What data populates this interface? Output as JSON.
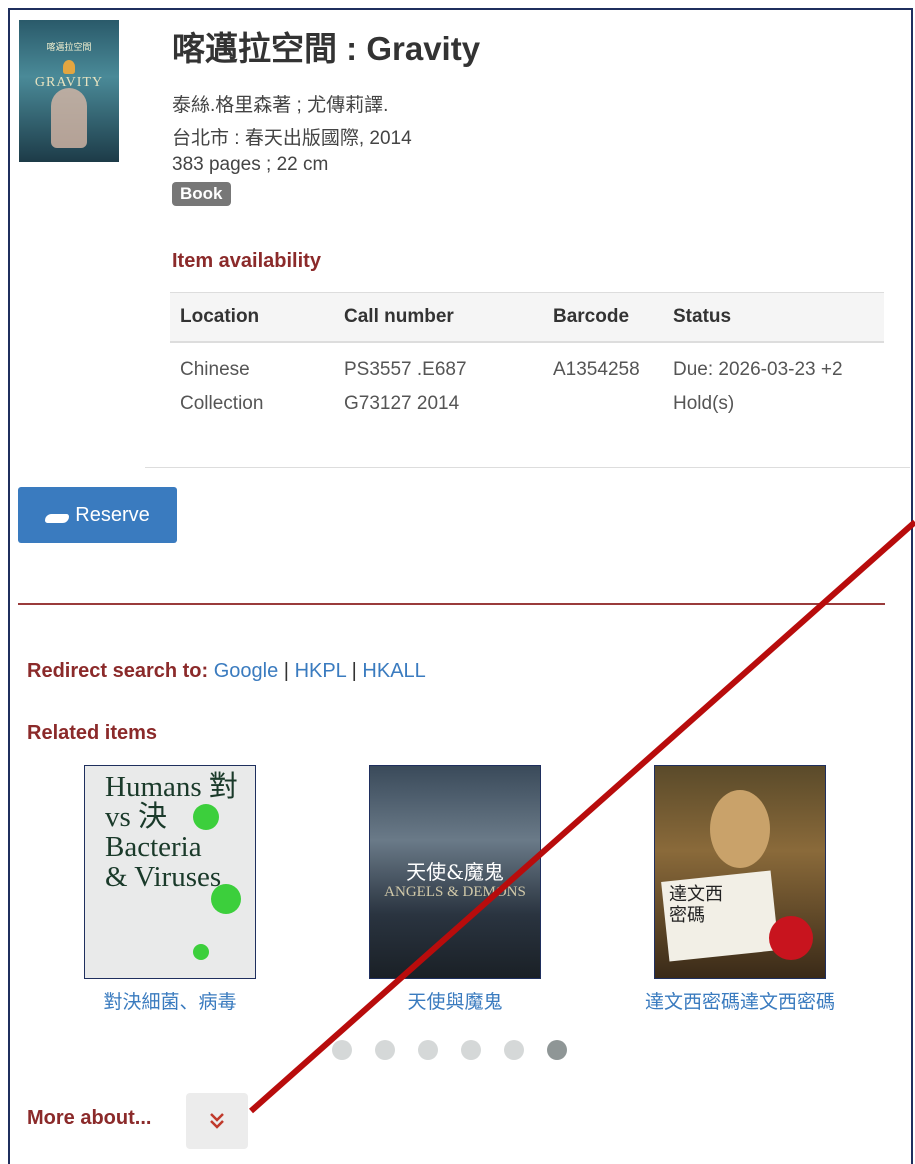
{
  "record": {
    "title": "喀邁拉空間 : Gravity",
    "author_line": "泰絲.格里森著 ; 尤傳莉譯.",
    "publisher_line": "台北市 : 春天出版國際, 2014",
    "physical_line": "383 pages ; 22 cm",
    "format_badge": "Book",
    "cover": {
      "title_cn": "喀邁拉空間",
      "title_en": "GRAVITY"
    }
  },
  "availability": {
    "heading": "Item availability",
    "columns": [
      "Location",
      "Call number",
      "Barcode",
      "Status"
    ],
    "rows": [
      {
        "location_l1": "Chinese",
        "location_l2": "Collection",
        "call_l1": "PS3557 .E687",
        "call_l2": "G73127 2014",
        "barcode": "A1354258",
        "status_l1": "Due: 2026-03-23 +2",
        "status_l2": "Hold(s)"
      }
    ]
  },
  "actions": {
    "reserve_label": "Reserve"
  },
  "redirect": {
    "label": "Redirect search to:",
    "links": [
      "Google",
      "HKPL",
      "HKALL"
    ],
    "separator": "|"
  },
  "related": {
    "heading": "Related items",
    "items": [
      {
        "caption": "對決細菌、病毒",
        "cover_text": [
          "Humans 對",
          "vs    決",
          "Bacteria",
          "& Viruses"
        ]
      },
      {
        "caption": "天使與魔鬼",
        "cover_title": "天使&魔鬼",
        "cover_sub": "ANGELS & DEMONS"
      },
      {
        "caption": "達文西密碼達文西密碼",
        "cover_text": [
          "達文西",
          "密碼"
        ]
      }
    ],
    "carousel": {
      "pages": 6,
      "active_index": 5
    }
  },
  "more": {
    "label": "More about..."
  },
  "colors": {
    "accent_red": "#8b2a2a",
    "link_blue": "#3a7bbf",
    "button_blue": "#3a7bbf",
    "annotation_arrow": "#b80c0c"
  }
}
